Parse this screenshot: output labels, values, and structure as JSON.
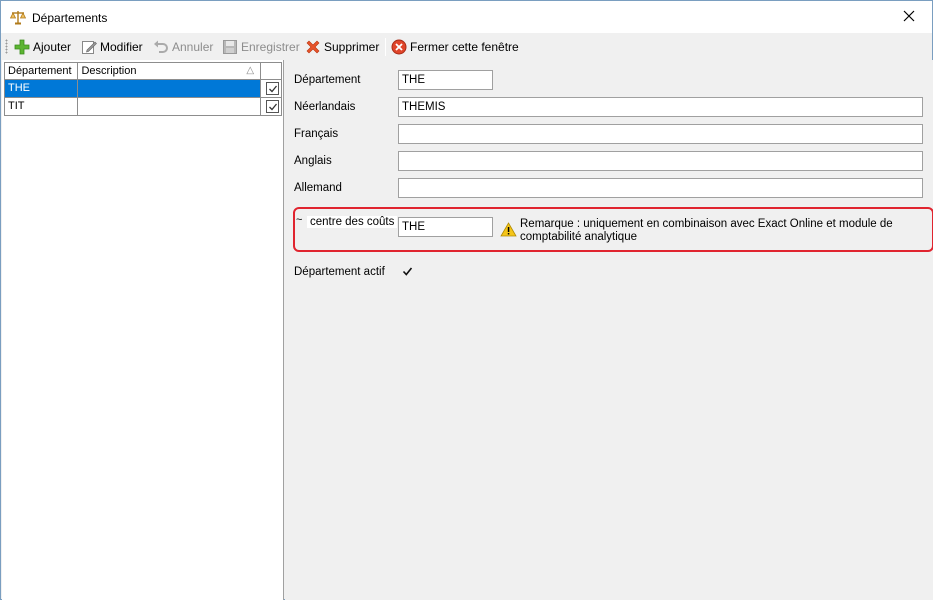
{
  "window": {
    "title": "Départements",
    "title_icon": "scales-icon",
    "close_icon": "close-icon"
  },
  "toolbar": {
    "add_label": "Ajouter",
    "edit_label": "Modifier",
    "cancel_label": "Annuler",
    "save_label": "Enregistrer",
    "delete_label": "Supprimer",
    "close_label": "Fermer cette fenêtre"
  },
  "grid": {
    "columns": [
      "Département",
      "Description"
    ],
    "rows": [
      {
        "code": "THE",
        "description": "",
        "checked": true,
        "selected": true
      },
      {
        "code": "TIT",
        "description": "",
        "checked": true,
        "selected": false
      }
    ]
  },
  "form": {
    "departement_label": "Département",
    "departement_value": "THE",
    "neerlandais_label": "Néerlandais",
    "neerlandais_value": "THEMIS",
    "francais_label": "Français",
    "francais_value": "",
    "anglais_label": "Anglais",
    "anglais_value": "",
    "allemand_label": "Allemand",
    "allemand_value": "",
    "cost_center_label": "centre des coûts",
    "cost_center_prefix": "~",
    "cost_center_value": "THE",
    "remark": "Remarque : uniquement en combinaison avec Exact Online et module de comptabilité analytique",
    "actif_label": "Département actif",
    "actif_checked": true
  },
  "colors": {
    "selection": "#0078d7",
    "highlight_border": "#e0242f"
  }
}
